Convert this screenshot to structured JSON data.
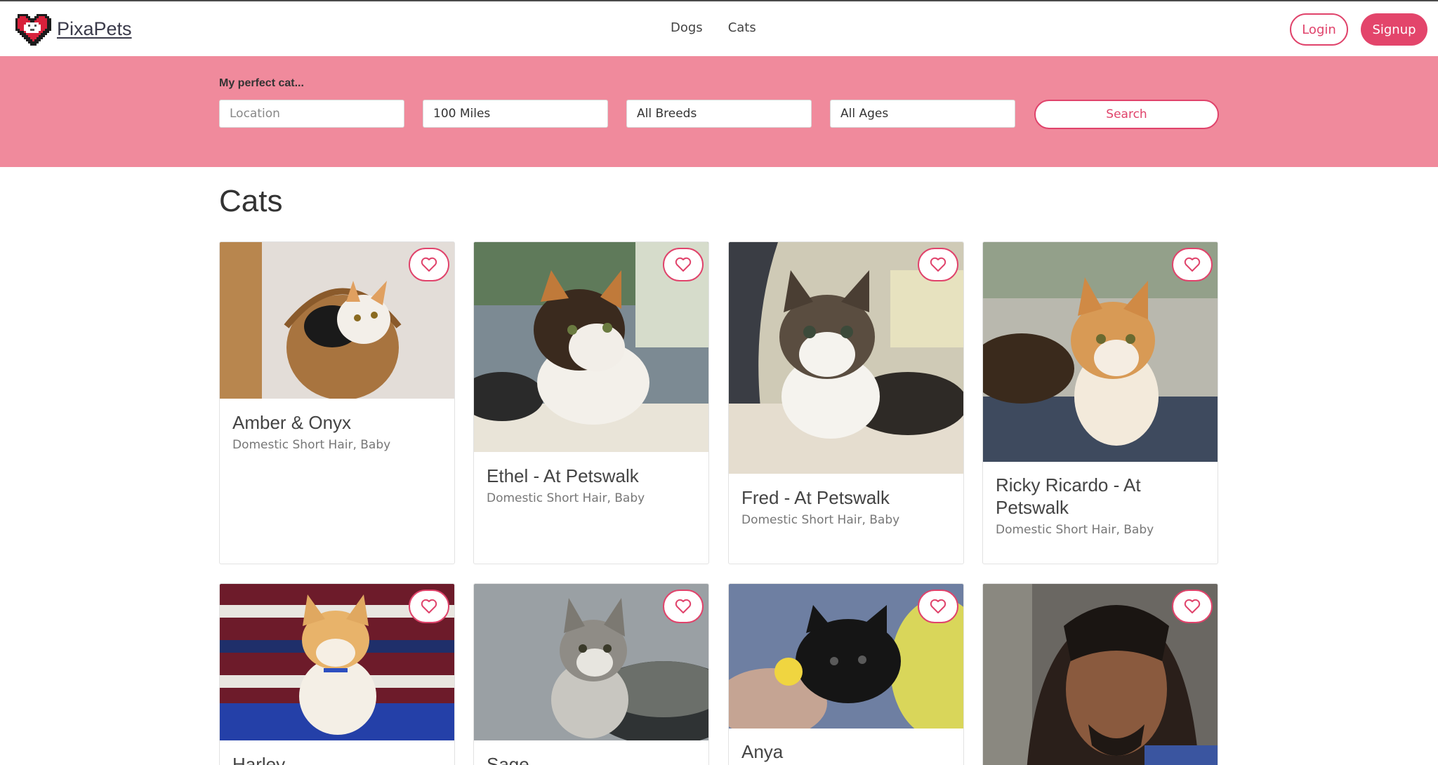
{
  "header": {
    "brand": "PixaPets",
    "nav": [
      "Dogs",
      "Cats"
    ],
    "login_label": "Login",
    "signup_label": "Signup"
  },
  "search": {
    "title": "My perfect cat...",
    "location_placeholder": "Location",
    "distance": "100 Miles",
    "breed": "All Breeds",
    "age": "All Ages",
    "button_label": "Search"
  },
  "main": {
    "heading": "Cats",
    "cards": [
      {
        "name": "Amber & Onyx",
        "details": "Domestic Short Hair, Baby"
      },
      {
        "name": "Ethel - At Petswalk",
        "details": "Domestic Short Hair, Baby"
      },
      {
        "name": "Fred - At Petswalk",
        "details": "Domestic Short Hair, Baby"
      },
      {
        "name": "Ricky Ricardo - At Petswalk",
        "details": "Domestic Short Hair, Baby"
      },
      {
        "name": "Harley",
        "details": ""
      },
      {
        "name": "Sage",
        "details": ""
      },
      {
        "name": "Anya",
        "details": ""
      },
      {
        "name": "",
        "details": ""
      }
    ]
  },
  "colors": {
    "accent": "#e0436b",
    "band": "#f08a9c"
  },
  "icons": [
    "pixel-heart-logo-icon",
    "heart-outline-icon"
  ]
}
